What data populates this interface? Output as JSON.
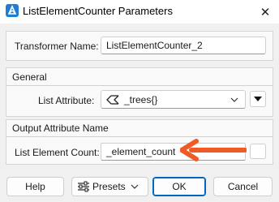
{
  "window": {
    "title": "ListElementCounter Parameters",
    "close_glyph": "✕"
  },
  "transformer": {
    "label": "Transformer Name:",
    "value": "ListElementCounter_2"
  },
  "general": {
    "title": "General",
    "list_attribute_label": "List Attribute:",
    "list_attribute_value": "_trees{}",
    "list_icon": "list-attribute-icon"
  },
  "output": {
    "title": "Output Attribute Name",
    "count_label": "List Element Count:",
    "count_value": "_element_count"
  },
  "buttons": {
    "help": "Help",
    "presets": "Presets",
    "ok": "OK",
    "cancel": "Cancel"
  },
  "colors": {
    "accent": "#0067c0",
    "annotation_arrow": "#f05a24",
    "app_icon": "#1f7ed1"
  }
}
